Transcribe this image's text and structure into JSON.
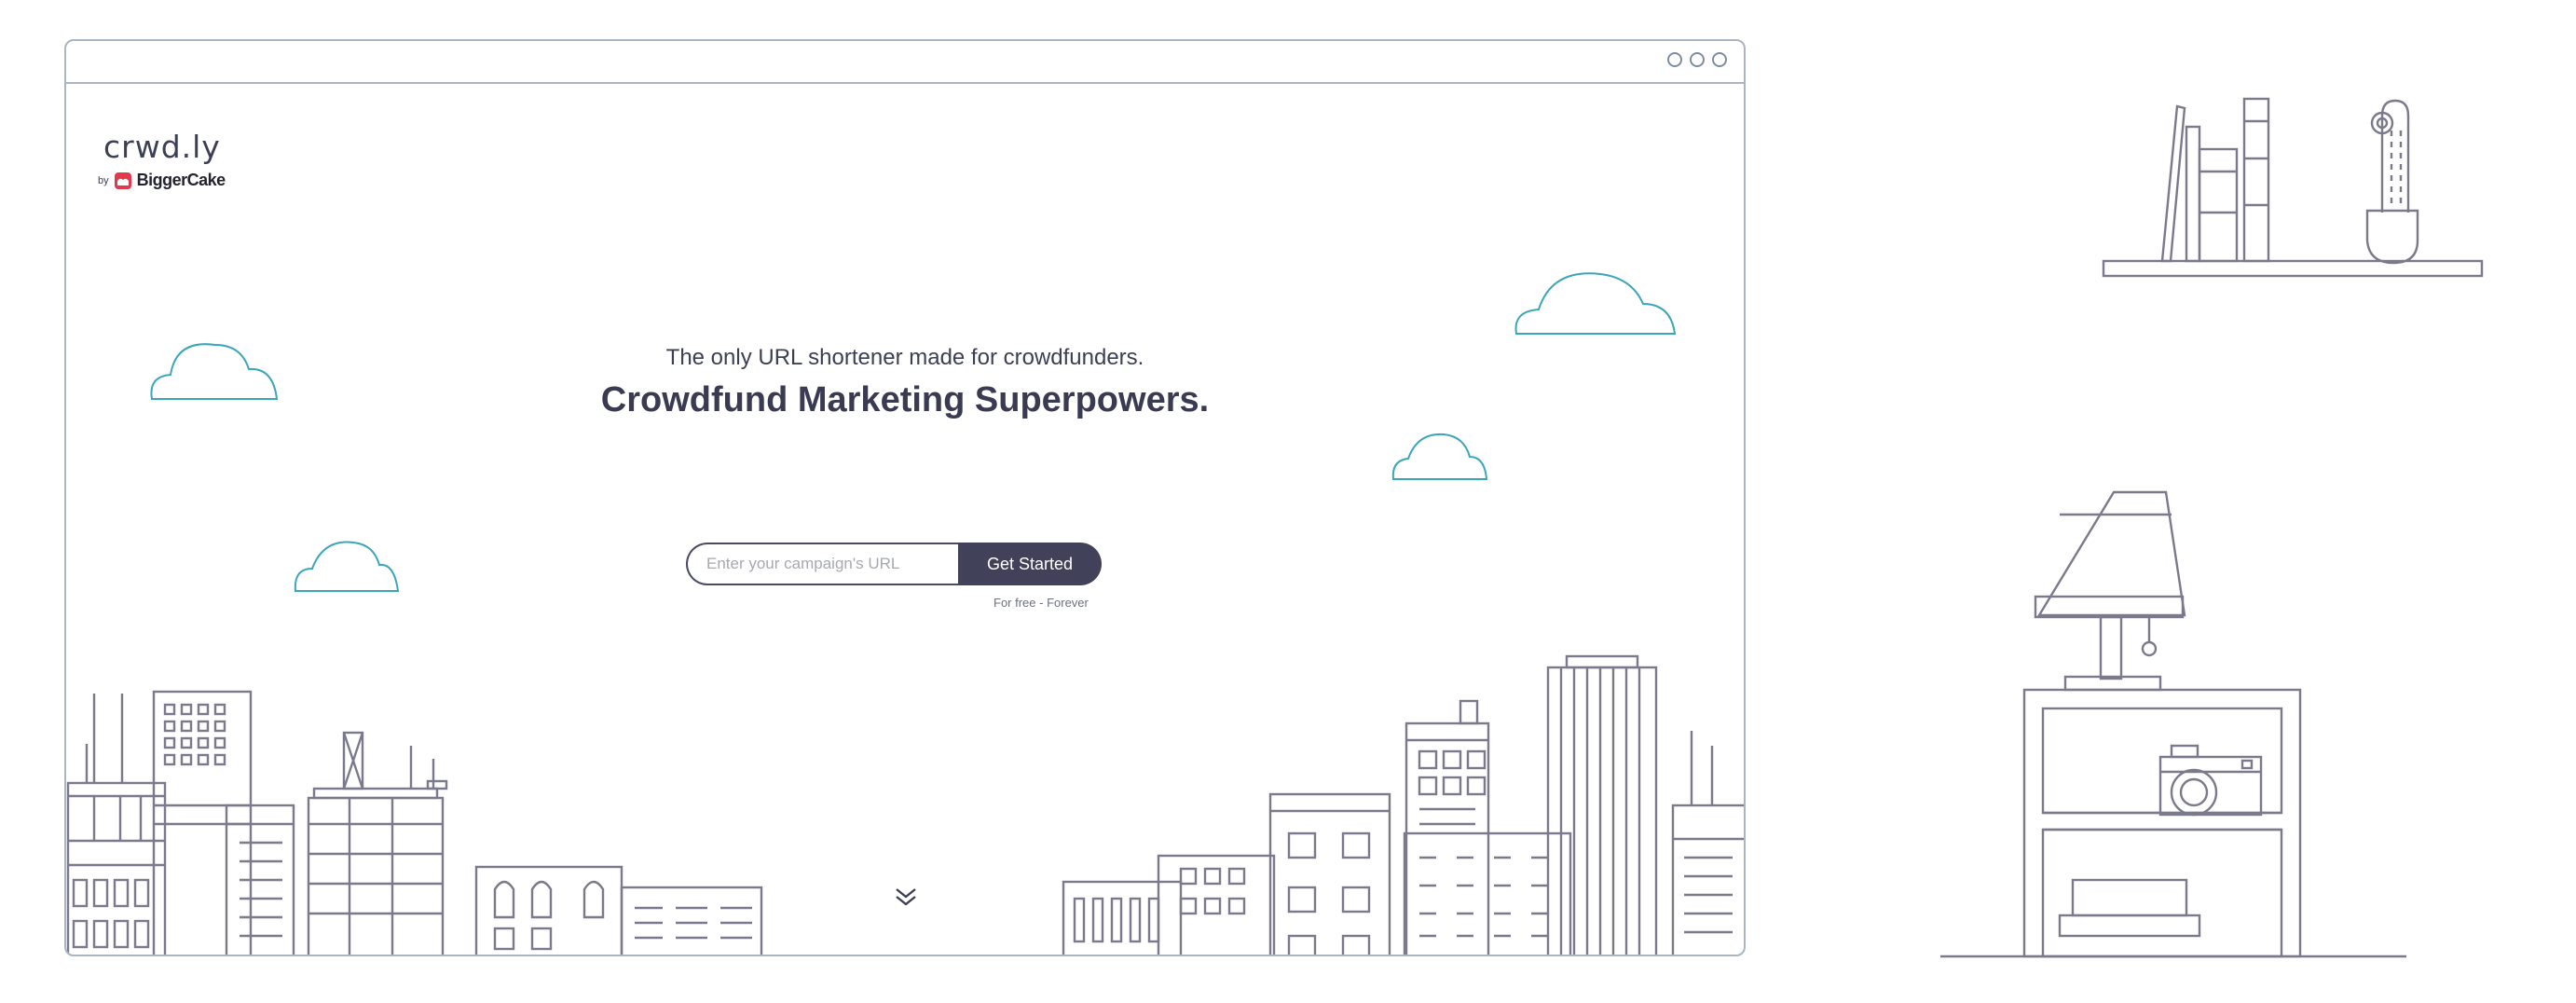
{
  "browser": {
    "window_controls": [
      "window-dot-1",
      "window-dot-2",
      "window-dot-3"
    ]
  },
  "brand": {
    "logo": "crwd.ly",
    "by_label": "by",
    "company": "BiggerCake"
  },
  "hero": {
    "tagline": "The only URL shortener made for crowdfunders.",
    "headline": "Crowdfund Marketing Superpowers."
  },
  "signup": {
    "url_placeholder": "Enter your campaign's URL",
    "url_value": "",
    "cta_label": "Get Started",
    "fine_print": "For free - Forever"
  },
  "icons": {
    "scroll": "chevron-double-down-icon",
    "brand_mark": "biggercake-logo-icon"
  },
  "colors": {
    "ink": "#3c3f55",
    "cta_background": "#41415a",
    "cloud_outline": "#3aa6b9",
    "frame_outline": "#a9b6c2",
    "brand_red": "#e3394e"
  }
}
